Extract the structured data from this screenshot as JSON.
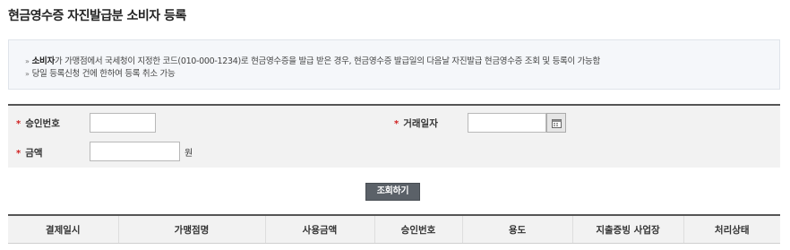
{
  "page": {
    "title": "현금영수증 자진발급분 소비자 등록"
  },
  "notice": {
    "line1_bold": "소비자",
    "line1_rest": "가 가맹점에서 국세청이 지정한 코드(010-000-1234)로 현금영수증을 발급 받은 경우, 현금영수증 발급일의 다음날 자진발급 현금영수증 조회 및 등록이 가능함",
    "line2": "당일 등록신청 건에 한하여 등록 취소 가능",
    "bullet": "»"
  },
  "search": {
    "required_mark": "*",
    "approval_label": "승인번호",
    "approval_value": "",
    "date_label": "거래일자",
    "date_value": "",
    "amount_label": "금액",
    "amount_value": "",
    "amount_unit": "원",
    "submit_label": "조회하기"
  },
  "table": {
    "columns": [
      "결제일시",
      "가맹점명",
      "사용금액",
      "승인번호",
      "용도",
      "지출증빙 사업장",
      "처리상태"
    ]
  },
  "icons": {
    "calendar": "calendar-icon"
  },
  "colors": {
    "required": "#d02020",
    "button_bg": "#5b6168",
    "notice_bg": "#f5f7fa"
  }
}
